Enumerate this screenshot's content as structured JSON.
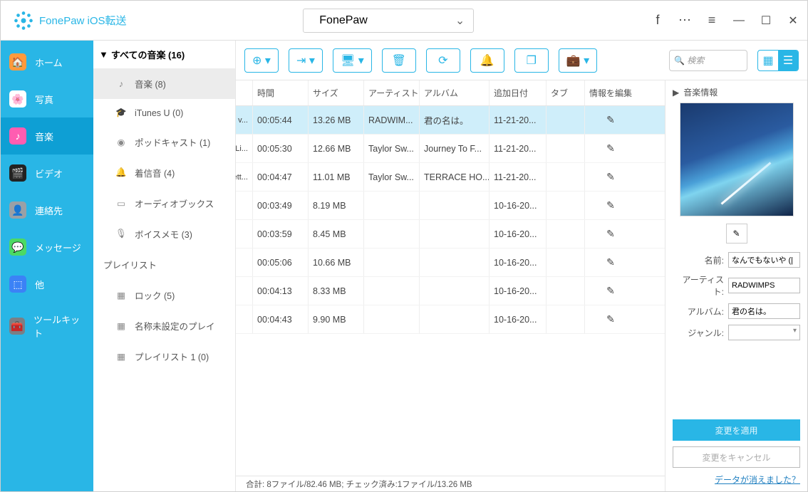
{
  "app": {
    "title": "FonePaw iOS転送"
  },
  "device": {
    "name": "FonePaw"
  },
  "sidebar": {
    "items": [
      {
        "label": "ホーム",
        "icon_bg": "#ff9a3c"
      },
      {
        "label": "写真",
        "icon_bg": "#fff"
      },
      {
        "label": "音楽",
        "icon_bg": "#ff5db1"
      },
      {
        "label": "ビデオ",
        "icon_bg": "#222"
      },
      {
        "label": "連絡先",
        "icon_bg": "#9aa0a6"
      },
      {
        "label": "メッセージ",
        "icon_bg": "#4cd964"
      },
      {
        "label": "他",
        "icon_bg": "#3b82f6"
      },
      {
        "label": "ツールキット",
        "icon_bg": "#7a7f85"
      }
    ]
  },
  "tree": {
    "header": "すべての音楽 (16)",
    "nodes": [
      {
        "label": "音楽 (8)",
        "icon": "♪"
      },
      {
        "label": "iTunes U (0)",
        "icon": "🎓"
      },
      {
        "label": "ポッドキャスト (1)",
        "icon": "◉"
      },
      {
        "label": "着信音 (4)",
        "icon": "🔔"
      },
      {
        "label": "オーディオブックス",
        "icon": "▭"
      },
      {
        "label": "ボイスメモ (3)",
        "icon": "🎙"
      }
    ],
    "playlist_header": "プレイリスト",
    "playlists": [
      {
        "label": "ロック (5)"
      },
      {
        "label": "名称未設定のプレイ"
      },
      {
        "label": "プレイリスト 1 (0)"
      }
    ]
  },
  "search": {
    "placeholder": "検索"
  },
  "columns": {
    "time": "時間",
    "size": "サイズ",
    "artist": "アーティスト",
    "album": "アルバム",
    "date": "追加日付",
    "tag": "タブ",
    "edit": "情報を編集"
  },
  "rows": [
    {
      "name": "ie v...",
      "time": "00:05:44",
      "size": "13.26 MB",
      "artist": "RADWIM...",
      "album": "君の名は。",
      "date": "11-21-20..."
    },
    {
      "name": "(Li...",
      "time": "00:05:30",
      "size": "12.66 MB",
      "artist": "Taylor Sw...",
      "album": "Journey To F...",
      "date": "11-21-20..."
    },
    {
      "name": "Sett...",
      "time": "00:04:47",
      "size": "11.01 MB",
      "artist": "Taylor Sw...",
      "album": "TERRACE HO...",
      "date": "11-21-20..."
    },
    {
      "name": "",
      "time": "00:03:49",
      "size": "8.19 MB",
      "artist": "",
      "album": "",
      "date": "10-16-20..."
    },
    {
      "name": "",
      "time": "00:03:59",
      "size": "8.45 MB",
      "artist": "",
      "album": "",
      "date": "10-16-20..."
    },
    {
      "name": "",
      "time": "00:05:06",
      "size": "10.66 MB",
      "artist": "",
      "album": "",
      "date": "10-16-20..."
    },
    {
      "name": "",
      "time": "00:04:13",
      "size": "8.33 MB",
      "artist": "",
      "album": "",
      "date": "10-16-20..."
    },
    {
      "name": "",
      "time": "00:04:43",
      "size": "9.90 MB",
      "artist": "",
      "album": "",
      "date": "10-16-20..."
    }
  ],
  "info": {
    "header": "音楽情報",
    "name_label": "名前:",
    "name_value": "なんでもないや (|",
    "artist_label": "アーティスト:",
    "artist_value": "RADWIMPS",
    "album_label": "アルバム:",
    "album_value": "君の名は。",
    "genre_label": "ジャンル:",
    "apply": "変更を適用",
    "cancel": "変更をキャンセル",
    "link": "データが消えました？"
  },
  "status": "合計: 8ファイル/82.46 MB; チェック済み:1ファイル/13.26 MB"
}
